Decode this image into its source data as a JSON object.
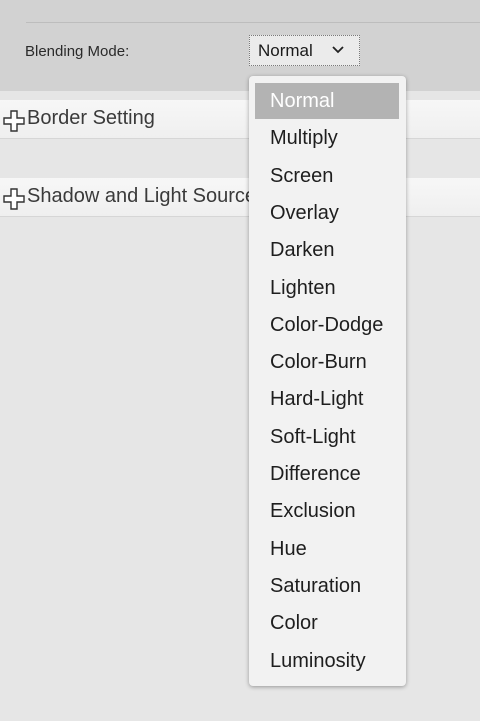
{
  "blending": {
    "label": "Blending Mode:",
    "value": "Normal"
  },
  "sections": {
    "border": "Border Setting",
    "shadow": "Shadow and Light Source"
  },
  "dropdown": {
    "selected": "Normal",
    "options": [
      "Normal",
      "Multiply",
      "Screen",
      "Overlay",
      "Darken",
      "Lighten",
      "Color-Dodge",
      "Color-Burn",
      "Hard-Light",
      "Soft-Light",
      "Difference",
      "Exclusion",
      "Hue",
      "Saturation",
      "Color",
      "Luminosity"
    ]
  },
  "icons": {
    "expand": "plus-icon",
    "select_arrow": "chevron-down-icon"
  },
  "colors": {
    "selected_option_bg": "#b3b3b3",
    "panel_bg": "#d2d2d2",
    "page_bg": "#e6e6e6"
  }
}
